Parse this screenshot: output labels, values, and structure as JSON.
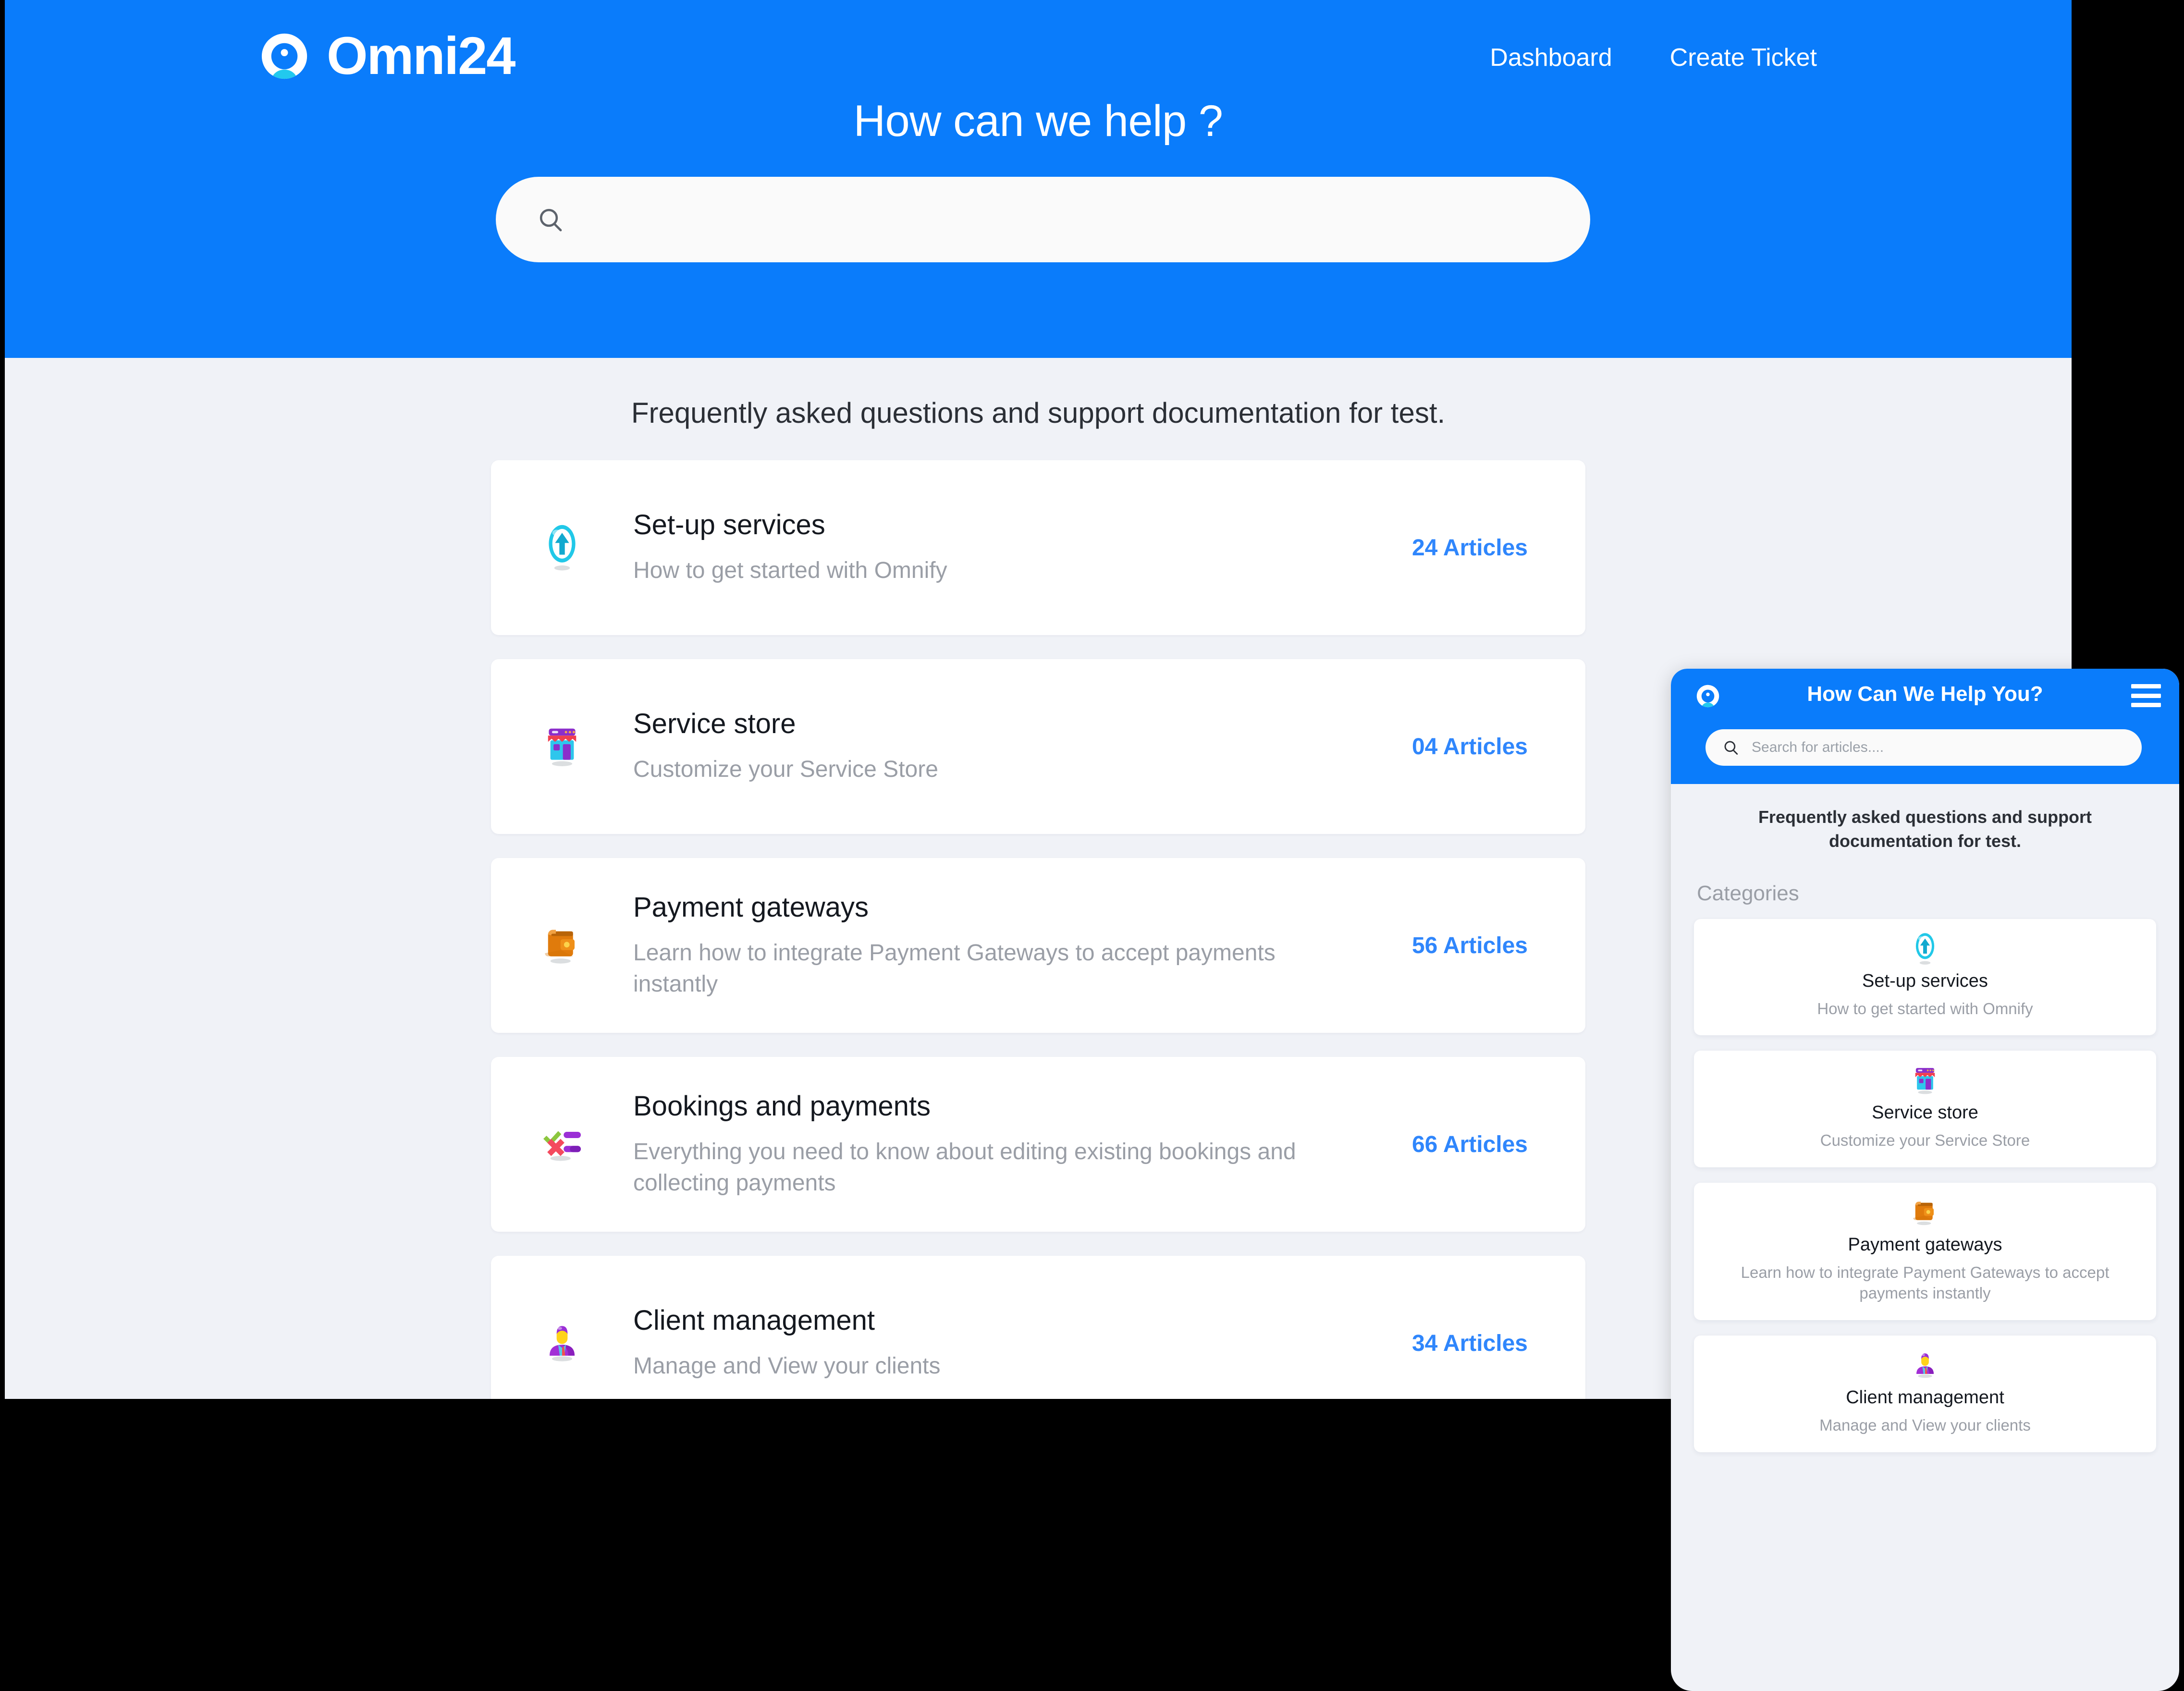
{
  "colors": {
    "brand_blue": "#0a7cfb",
    "page_bg": "#f0f2f7",
    "card_bg": "#ffffff",
    "count_blue": "#2f86fc",
    "muted_text": "#9a9ea6",
    "title_text": "#14181f",
    "logo_cyan": "#22c9ee"
  },
  "desktop": {
    "brand": {
      "name": "Omni24",
      "logo_icon": "omnify-circle-avatar-logo"
    },
    "nav": [
      {
        "label": "Dashboard"
      },
      {
        "label": "Create Ticket"
      }
    ],
    "hero": {
      "title": "How can we help ?",
      "search": {
        "value": "",
        "placeholder": "",
        "icon": "search-icon"
      }
    },
    "subtitle": "Frequently asked questions and support documentation for test.",
    "cards": [
      {
        "title": "Set-up services",
        "desc": "How to get started with Omnify",
        "count": "24 Articles",
        "icon": "up-arrow-circle-icon"
      },
      {
        "title": "Service store",
        "desc": "Customize your Service Store",
        "count": "04 Articles",
        "icon": "storefront-icon"
      },
      {
        "title": "Payment gateways",
        "desc": "Learn how to integrate Payment Gateways to accept payments instantly",
        "count": "56 Articles",
        "icon": "wallet-icon"
      },
      {
        "title": "Bookings and payments",
        "desc": "Everything you need to know about editing existing bookings and collecting payments",
        "count": "66 Articles",
        "icon": "checklist-icon"
      },
      {
        "title": "Client management",
        "desc": "Manage and View your clients",
        "count": "34 Articles",
        "icon": "person-in-suit-icon"
      }
    ]
  },
  "mobile": {
    "logo_icon": "omnify-circle-avatar-logo",
    "title": "How Can We Help You?",
    "menu_icon": "hamburger-menu-icon",
    "search": {
      "value": "",
      "placeholder": "Search for articles....",
      "icon": "search-icon"
    },
    "subtitle": "Frequently asked questions and support documentation for test.",
    "categories_label": "Categories",
    "cards": [
      {
        "title": "Set-up services",
        "desc": "How to get started with Omnify",
        "icon": "up-arrow-circle-icon"
      },
      {
        "title": "Service store",
        "desc": "Customize your Service Store",
        "icon": "storefront-icon"
      },
      {
        "title": "Payment gateways",
        "desc": "Learn how to integrate Payment Gateways to accept payments instantly",
        "icon": "wallet-icon"
      },
      {
        "title": "Client management",
        "desc": "Manage and View your clients",
        "icon": "person-in-suit-icon"
      }
    ]
  }
}
